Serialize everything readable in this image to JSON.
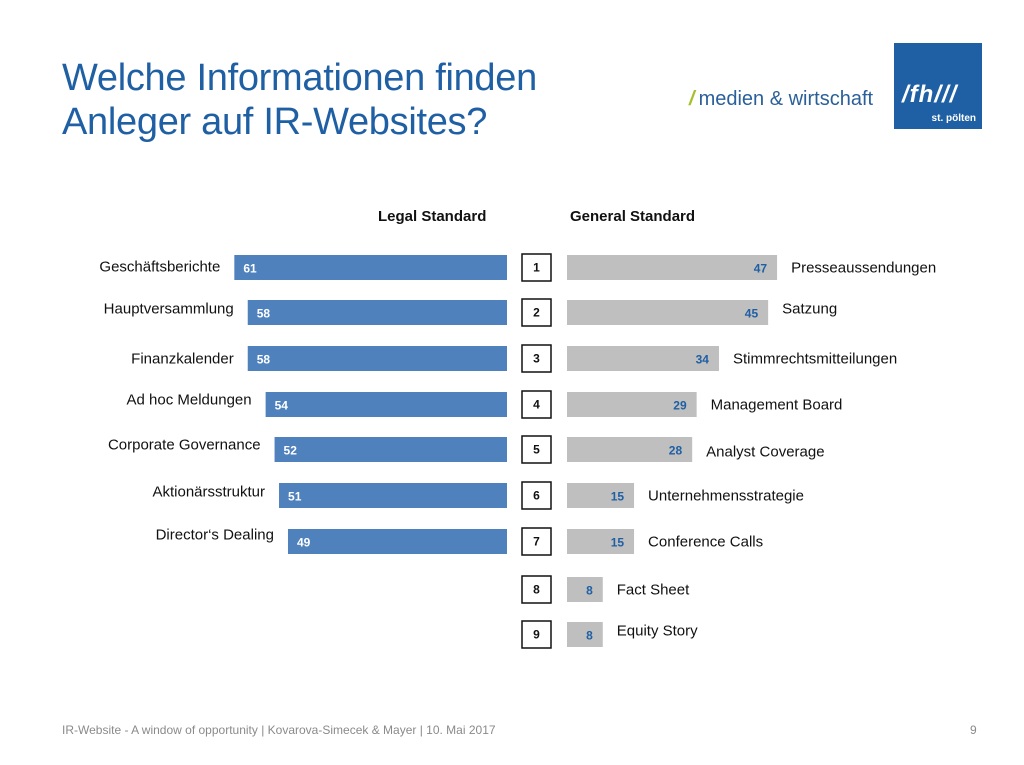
{
  "slide": {
    "title_line1": "Welche Informationen finden",
    "title_line2": "Anleger auf IR-Websites?",
    "brand_slash": "/",
    "brand_text": "medien & wirtschaft",
    "logo_text": "/fh///",
    "logo_subtext": "st. pölten",
    "footer": "IR-Website - A window of opportunity | Kovarova-Simecek & Mayer | 10. Mai 2017",
    "page_number": "9"
  },
  "colors": {
    "legal_bar": "#4f81bd",
    "general_bar": "#bfbfbf",
    "general_value_text": "#1f5fa3",
    "legal_value_text": "#ffffff",
    "title": "#1f5fa3"
  },
  "chart_data": {
    "type": "bar",
    "orientation": "horizontal-butterfly",
    "title": "Welche Informationen finden Anleger auf IR-Websites?",
    "ranks": [
      "1",
      "2",
      "3",
      "4",
      "5",
      "6",
      "7",
      "8",
      "9"
    ],
    "series": [
      {
        "name": "Legal Standard",
        "categories": [
          "Geschäftsberichte",
          "Hauptversammlung",
          "Finanzkalender",
          "Ad hoc Meldungen",
          "Corporate Governance",
          "Aktionärsstruktur",
          "Director‘s Dealing"
        ],
        "values": [
          61,
          58,
          58,
          54,
          52,
          51,
          49
        ]
      },
      {
        "name": "General Standard",
        "categories": [
          "Presseaussendungen",
          "Satzung",
          "Stimmrechtsmitteilungen",
          "Management Board",
          "Analyst Coverage",
          "Unternehmensstrategie",
          "Conference Calls",
          "Fact Sheet",
          "Equity Story"
        ],
        "values": [
          47,
          45,
          34,
          29,
          28,
          15,
          15,
          8,
          8
        ]
      }
    ],
    "xlabel": "",
    "ylabel": "",
    "xlim": [
      0,
      61
    ],
    "grid": false,
    "legend": "column headers above each side"
  }
}
